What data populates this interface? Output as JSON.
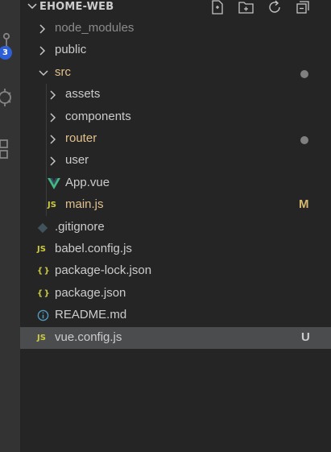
{
  "colors": {
    "background": "#252526",
    "activity_bar": "#333333",
    "selected_row": "#4b4c4e",
    "default_text": "#cccccc",
    "ignored_text": "#8c8c8c",
    "modified_text": "#e2c08d",
    "modified_status": "#d6b86e",
    "untracked_status": "#cccccc",
    "js_icon": "#cbcb41",
    "json_icon": "#cbcb41",
    "vue_icon": "#41b883",
    "info_icon": "#519aba",
    "git_icon": "#41535b",
    "badge": "#2f5fd6"
  },
  "activity_bar": {
    "scm_badge": "3",
    "icons": [
      "source-control-icon",
      "debug-icon",
      "extensions-icon"
    ]
  },
  "explorer": {
    "title": "EHOME-WEB",
    "actions": [
      "new-file-icon",
      "new-folder-icon",
      "refresh-icon",
      "collapse-all-icon"
    ]
  },
  "tree": [
    {
      "label": "node_modules",
      "kind": "folder",
      "expanded": false,
      "depth": 0,
      "tone": "ignored",
      "status": "",
      "dot": false
    },
    {
      "label": "public",
      "kind": "folder",
      "expanded": false,
      "depth": 0,
      "tone": "default",
      "status": "",
      "dot": false
    },
    {
      "label": "src",
      "kind": "folder",
      "expanded": true,
      "depth": 0,
      "tone": "modified",
      "status": "",
      "dot": true
    },
    {
      "label": "assets",
      "kind": "folder",
      "expanded": false,
      "depth": 1,
      "tone": "default",
      "status": "",
      "dot": false
    },
    {
      "label": "components",
      "kind": "folder",
      "expanded": false,
      "depth": 1,
      "tone": "default",
      "status": "",
      "dot": false
    },
    {
      "label": "router",
      "kind": "folder",
      "expanded": false,
      "depth": 1,
      "tone": "modified",
      "status": "",
      "dot": true
    },
    {
      "label": "user",
      "kind": "folder",
      "expanded": false,
      "depth": 1,
      "tone": "default",
      "status": "",
      "dot": false
    },
    {
      "label": "App.vue",
      "kind": "vue",
      "depth": 1,
      "tone": "default",
      "status": "",
      "dot": false
    },
    {
      "label": "main.js",
      "kind": "js",
      "depth": 1,
      "tone": "modified",
      "status": "M",
      "dot": false
    },
    {
      "label": ".gitignore",
      "kind": "git",
      "depth": 0,
      "tone": "default",
      "status": "",
      "dot": false
    },
    {
      "label": "babel.config.js",
      "kind": "js",
      "depth": 0,
      "tone": "default",
      "status": "",
      "dot": false
    },
    {
      "label": "package-lock.json",
      "kind": "json",
      "depth": 0,
      "tone": "default",
      "status": "",
      "dot": false
    },
    {
      "label": "package.json",
      "kind": "json",
      "depth": 0,
      "tone": "default",
      "status": "",
      "dot": false
    },
    {
      "label": "README.md",
      "kind": "info",
      "depth": 0,
      "tone": "default",
      "status": "",
      "dot": false
    },
    {
      "label": "vue.config.js",
      "kind": "js",
      "depth": 0,
      "tone": "default",
      "status": "U",
      "dot": false,
      "selected": true
    }
  ]
}
